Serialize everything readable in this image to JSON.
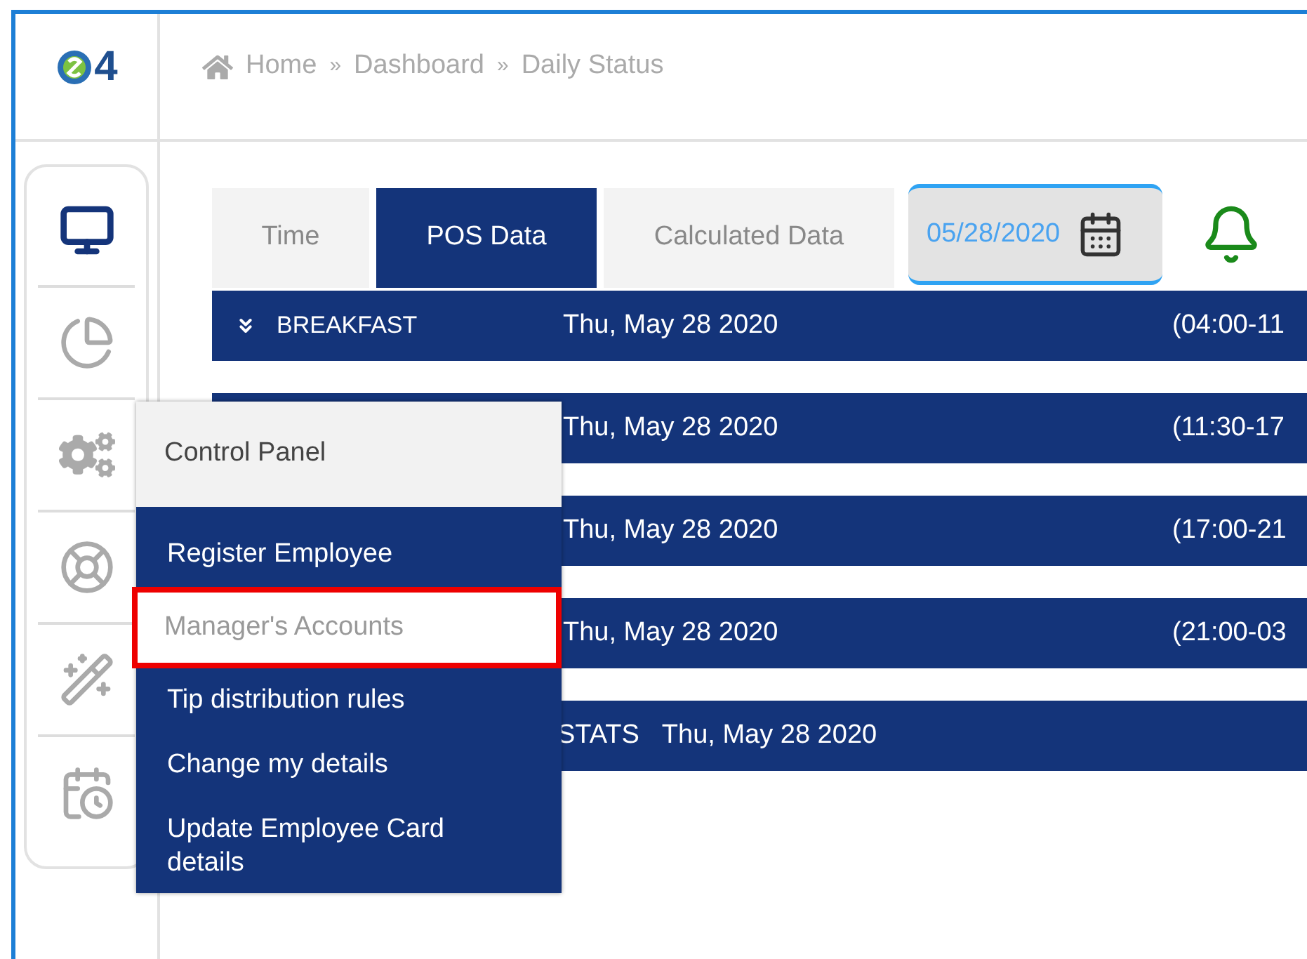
{
  "logo": {
    "text": "4"
  },
  "breadcrumb": [
    "Home",
    "Dashboard",
    "Daily Status"
  ],
  "breadcrumb_separators": [
    "»",
    "»"
  ],
  "sidebar": {
    "items": [
      {
        "selected": true
      },
      {
        "selected": false
      },
      {
        "selected": false
      },
      {
        "selected": false
      },
      {
        "selected": false
      },
      {
        "selected": false
      }
    ]
  },
  "tabs": [
    {
      "label": "Time",
      "selected": false
    },
    {
      "label": "POS Data",
      "selected": true
    },
    {
      "label": "Calculated Data",
      "selected": false
    }
  ],
  "date_field": {
    "value": "05/28/2020"
  },
  "rows": [
    {
      "kind": "period",
      "label": "BREAKFAST",
      "date": "Thu, May 28 2020",
      "time": "(04:00-11"
    },
    {
      "kind": "period",
      "date": "Thu, May 28 2020",
      "time": "(11:30-17"
    },
    {
      "kind": "period",
      "date": "Thu, May 28 2020",
      "time": "(17:00-21"
    },
    {
      "kind": "period",
      "date": "Thu, May 28 2020",
      "time": "(21:00-03"
    },
    {
      "kind": "stats",
      "label": "STATS",
      "date": "Thu, May 28 2020"
    }
  ],
  "control_panel_menu": {
    "title": "Control Panel",
    "items": [
      {
        "label": "Register Employee",
        "selected": false
      },
      {
        "label": "Manager's Accounts",
        "selected": true
      },
      {
        "label": "Tip distribution rules",
        "selected": false
      },
      {
        "label": "Change my details",
        "selected": false
      },
      {
        "label": "Update Employee Card details",
        "selected": false
      }
    ]
  }
}
